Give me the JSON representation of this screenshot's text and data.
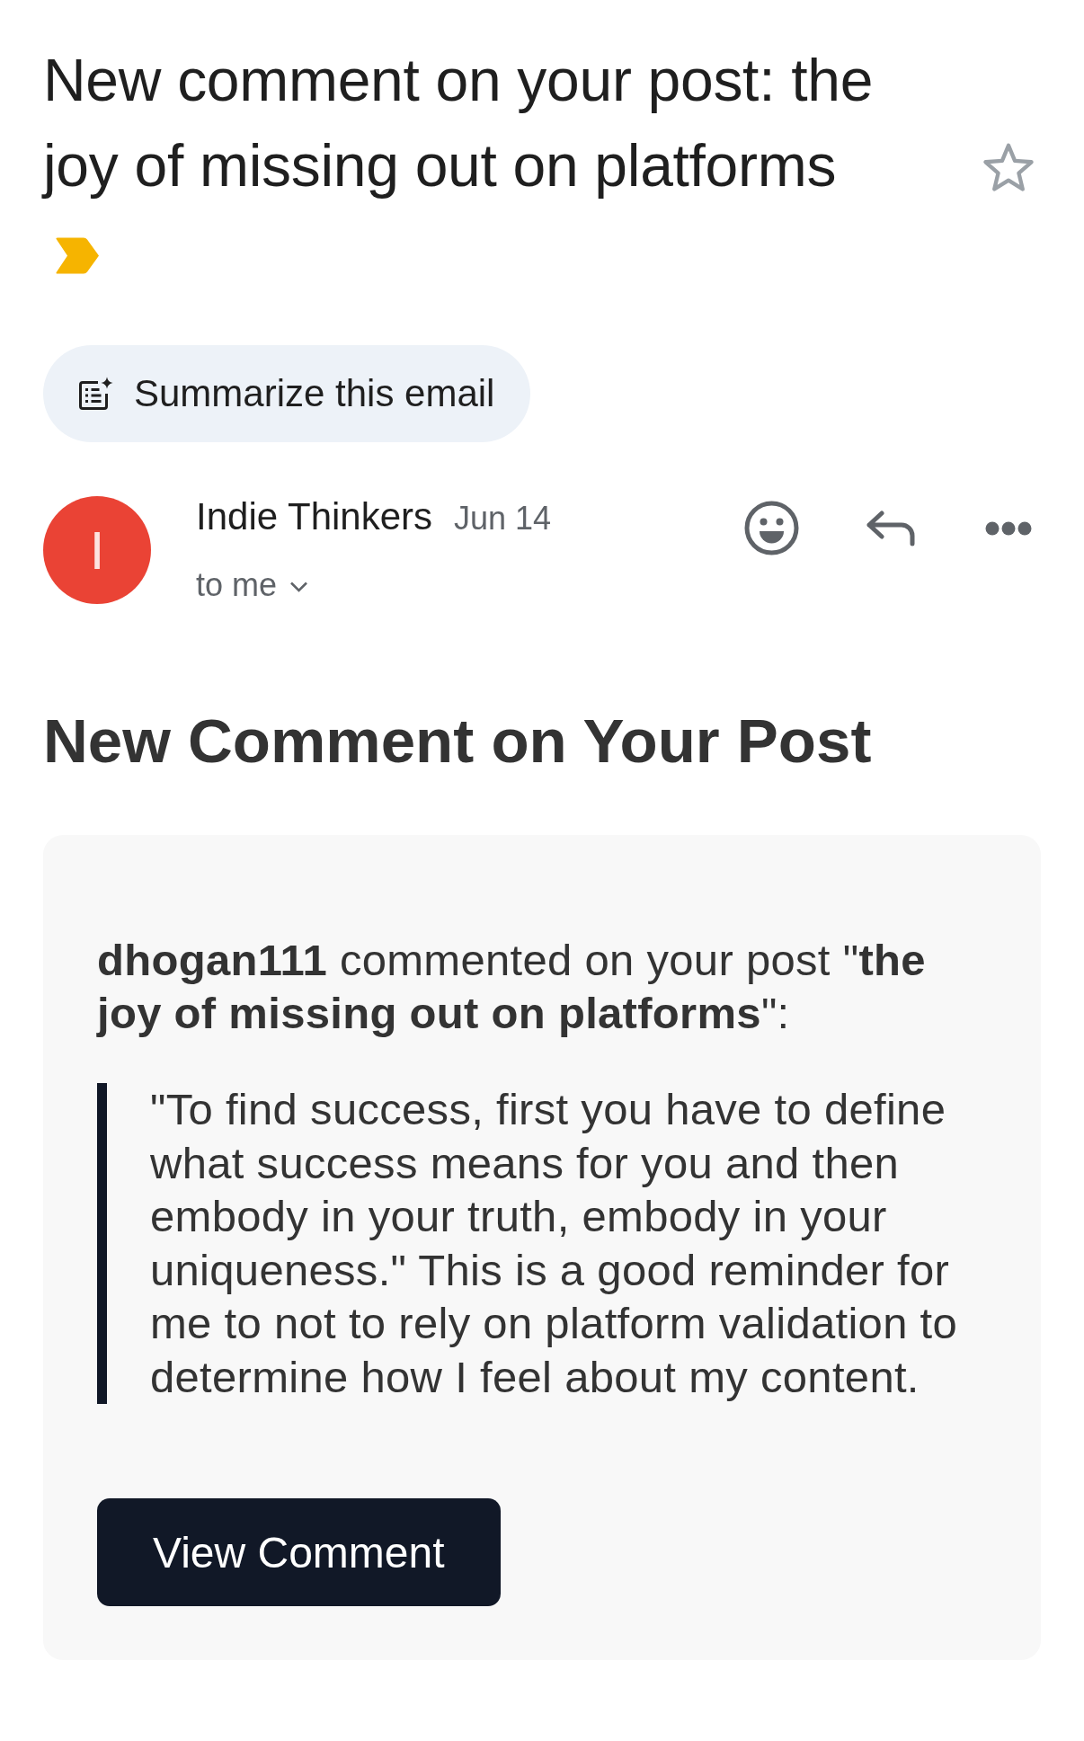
{
  "subject": {
    "text": "New comment on your post: the joy of missing out on platforms",
    "important": true,
    "starred": false
  },
  "summarize_button": {
    "label": "Summarize this email"
  },
  "sender": {
    "avatar_letter": "I",
    "name": "Indie Thinkers",
    "date": "Jun 14",
    "recipient": "to me",
    "details_expanded": false
  },
  "message": {
    "heading": "New Comment on Your Post",
    "intro": "**dhogan111** commented on your post \"**the joy of missing out on platforms**\":",
    "quote": "\"To find success, first you have to define what success means for you and then embody in your truth, embody in your uniqueness.\" This is a good reminder for me to not to rely on platform validation to determine how I feel about my content.",
    "button": "View Comment"
  }
}
